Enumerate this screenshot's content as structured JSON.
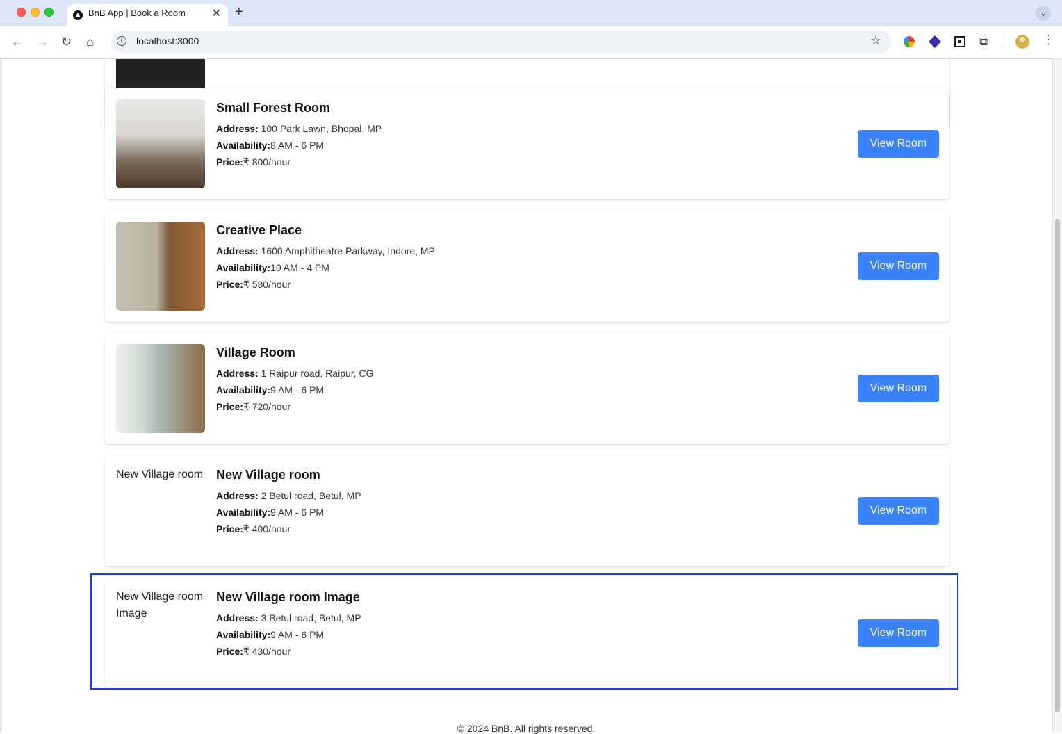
{
  "browser": {
    "tab_title": "BnB App | Book a Room",
    "close_glyph": "✕",
    "new_tab_glyph": "+",
    "tab_menu_glyph": "⌄",
    "url": "localhost:3000",
    "nav_back": "←",
    "nav_forward": "→",
    "nav_reload": "↻",
    "nav_home": "⌂",
    "info_glyph": "i",
    "star_glyph": "☆",
    "puzzle_glyph": "⧉",
    "kebab_glyph": "⋮"
  },
  "labels": {
    "address": "Address:",
    "availability": "Availability:",
    "price": "Price:",
    "view_button": "View Room"
  },
  "rooms": [
    {
      "title": "Small Forest Room",
      "address": "100 Park Lawn, Bhopal, MP",
      "availability": "8 AM - 6 PM",
      "price": "₹ 800/hour",
      "image_alt": ""
    },
    {
      "title": "Creative Place",
      "address": "1600 Amphitheatre Parkway, Indore, MP",
      "availability": "10 AM - 4 PM",
      "price": "₹ 580/hour",
      "image_alt": ""
    },
    {
      "title": "Village Room",
      "address": "1 Raipur road, Raipur, CG",
      "availability": "9 AM - 6 PM",
      "price": "₹ 720/hour",
      "image_alt": ""
    },
    {
      "title": "New Village room",
      "address": "2 Betul road, Betul, MP",
      "availability": "9 AM - 6 PM",
      "price": "₹ 400/hour",
      "image_alt": "New Village room"
    },
    {
      "title": "New Village room Image",
      "address": "3 Betul road, Betul, MP",
      "availability": "9 AM - 6 PM",
      "price": "₹ 430/hour",
      "image_alt": "New Village room Image"
    }
  ],
  "footer": {
    "text": "© 2024 BnB. All rights reserved."
  },
  "colors": {
    "button": "#3b82f6",
    "highlight_border": "#1d3fe0"
  }
}
